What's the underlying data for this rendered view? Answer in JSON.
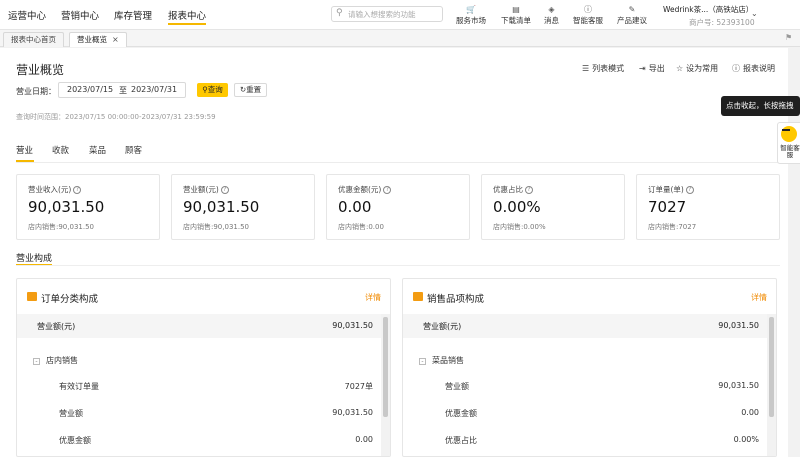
{
  "nav": [
    "运营中心",
    "营销中心",
    "库存管理",
    "报表中心"
  ],
  "search": {
    "placeholder": "请输入想搜索的功能"
  },
  "tools": [
    {
      "label": "服务市场",
      "icon": "cart-icon"
    },
    {
      "label": "下载清单",
      "icon": "download-list-icon"
    },
    {
      "label": "消息",
      "icon": "bell-icon"
    },
    {
      "label": "智能客服",
      "icon": "help-icon"
    },
    {
      "label": "产品建议",
      "icon": "suggestion-icon"
    }
  ],
  "store": {
    "name": "Wedrink茶...（高铁站店）",
    "merchant": "商户号: 52393100"
  },
  "tabs": [
    {
      "label": "报表中心首页"
    },
    {
      "label": "营业概览"
    }
  ],
  "page": {
    "title": "营业概览",
    "actions": [
      "列表模式",
      "导出",
      "设为常用",
      "报表说明"
    ],
    "date_label": "营业日期：",
    "date_start": "2023/07/15",
    "date_to": "至",
    "date_end": "2023/07/31",
    "query_btn": "查询",
    "reset_btn": "重置",
    "range_text": "查询时间范围：2023/07/15 00:00:00-2023/07/31 23:59:59"
  },
  "subtabs": [
    "营业",
    "收款",
    "菜品",
    "顾客"
  ],
  "cards": [
    {
      "title": "营业收入(元)",
      "value": "90,031.50",
      "sub": "店内销售:90,031.50"
    },
    {
      "title": "营业额(元)",
      "value": "90,031.50",
      "sub": "店内销售:90,031.50"
    },
    {
      "title": "优惠金额(元)",
      "value": "0.00",
      "sub": "店内销售:0.00"
    },
    {
      "title": "优惠占比",
      "value": "0.00%",
      "sub": "店内销售:0.00%"
    },
    {
      "title": "订单量(单)",
      "value": "7027",
      "sub": "店内销售:7027"
    }
  ],
  "section_title": "营业构成",
  "panels": [
    {
      "title": "订单分类构成",
      "detail": "详情",
      "header": {
        "label": "营业额(元)",
        "value": "90,031.50"
      },
      "group": "店内销售",
      "rows": [
        {
          "label": "有效订单量",
          "value": "7027单"
        },
        {
          "label": "营业额",
          "value": "90,031.50"
        },
        {
          "label": "优惠金额",
          "value": "0.00"
        }
      ]
    },
    {
      "title": "销售品项构成",
      "detail": "详情",
      "header": {
        "label": "营业额(元)",
        "value": "90,031.50"
      },
      "group": "菜品销售",
      "rows": [
        {
          "label": "营业额",
          "value": "90,031.50"
        },
        {
          "label": "优惠金额",
          "value": "0.00"
        },
        {
          "label": "优惠占比",
          "value": "0.00%"
        }
      ]
    }
  ],
  "tooltip": "点击收起，长按拖拽",
  "helper_label": "智能客服",
  "colors": {
    "accent": "#ffc800",
    "underline": "#f5b800",
    "detail": "#f08a00",
    "panel_icon": "#f39c12"
  }
}
